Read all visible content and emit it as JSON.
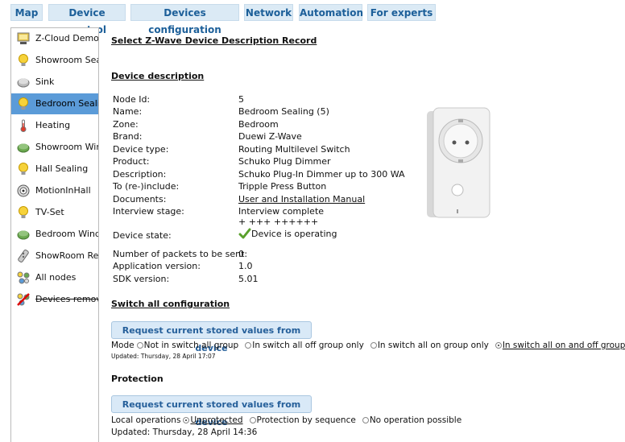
{
  "tabs": [
    "Map",
    "Device control",
    "Devices configuration",
    "Network",
    "Automation",
    "For experts"
  ],
  "sidebar": {
    "items": [
      {
        "label": "Z-Cloud Demo",
        "icon": "computer-icon"
      },
      {
        "label": "Showroom Seali",
        "icon": "bulb-icon"
      },
      {
        "label": "Sink",
        "icon": "grey-disc-icon"
      },
      {
        "label": "Bedroom Sealin",
        "icon": "bulb-icon"
      },
      {
        "label": "Heating",
        "icon": "thermometer-icon"
      },
      {
        "label": "Showroom Wind",
        "icon": "green-disc-icon"
      },
      {
        "label": "Hall Sealing",
        "icon": "bulb-icon"
      },
      {
        "label": "MotionInHall",
        "icon": "motion-sensor-icon"
      },
      {
        "label": "TV-Set",
        "icon": "bulb-icon"
      },
      {
        "label": "Bedroom Windo",
        "icon": "green-disc-icon"
      },
      {
        "label": "ShowRoom Rem",
        "icon": "remote-icon"
      },
      {
        "label": "All nodes",
        "icon": "nodes-icon"
      },
      {
        "label": "Devices remove",
        "icon": "removed-nodes-icon"
      }
    ]
  },
  "main": {
    "title": "Select Z-Wave Device Description Record",
    "device_description_header": "Device description",
    "fields": [
      {
        "label": "Node Id:",
        "value": "5"
      },
      {
        "label": "Name:",
        "value": "Bedroom Sealing (5)"
      },
      {
        "label": "Zone:",
        "value": "Bedroom"
      },
      {
        "label": "Brand:",
        "value": "Duewi Z-Wave"
      },
      {
        "label": "Device type:",
        "value": "Routing Multilevel Switch"
      },
      {
        "label": "Product:",
        "value": "Schuko Plug Dimmer"
      },
      {
        "label": "Description:",
        "value": "Schuko Plug-In Dimmer up to 300 WA"
      },
      {
        "label": "To (re-)include:",
        "value": "Tripple Press Button"
      },
      {
        "label": "Documents:",
        "value": "User and Installation Manual"
      },
      {
        "label": "Interview stage:",
        "value": "Interview complete"
      }
    ],
    "interview_progress": "+ +++ ++++++",
    "device_state_label": "Device state:",
    "device_state_value": "Device is operating",
    "extra_fields": [
      {
        "label": "Number of packets to be sent:",
        "value": "0"
      },
      {
        "label": "Application version:",
        "value": "1.0"
      },
      {
        "label": "SDK version:",
        "value": "5.01"
      }
    ],
    "switch_all": {
      "header": "Switch all configuration",
      "button": "Request current stored values from device",
      "mode_label": "Mode",
      "options": [
        "Not in switch all group",
        "In switch all off group only",
        "In switch all on group only",
        "In switch all on and off groups"
      ],
      "selected_index": 3,
      "updated": "Updated: Thursday, 28 April 17:07"
    },
    "protection": {
      "header": "Protection",
      "button": "Request current stored values from device",
      "local_label": "Local operations",
      "options": [
        "Unprotected",
        "Protection by sequence",
        "No operation possible"
      ],
      "selected_index": 0,
      "updated": "Updated: Thursday, 28 April 14:36"
    }
  }
}
